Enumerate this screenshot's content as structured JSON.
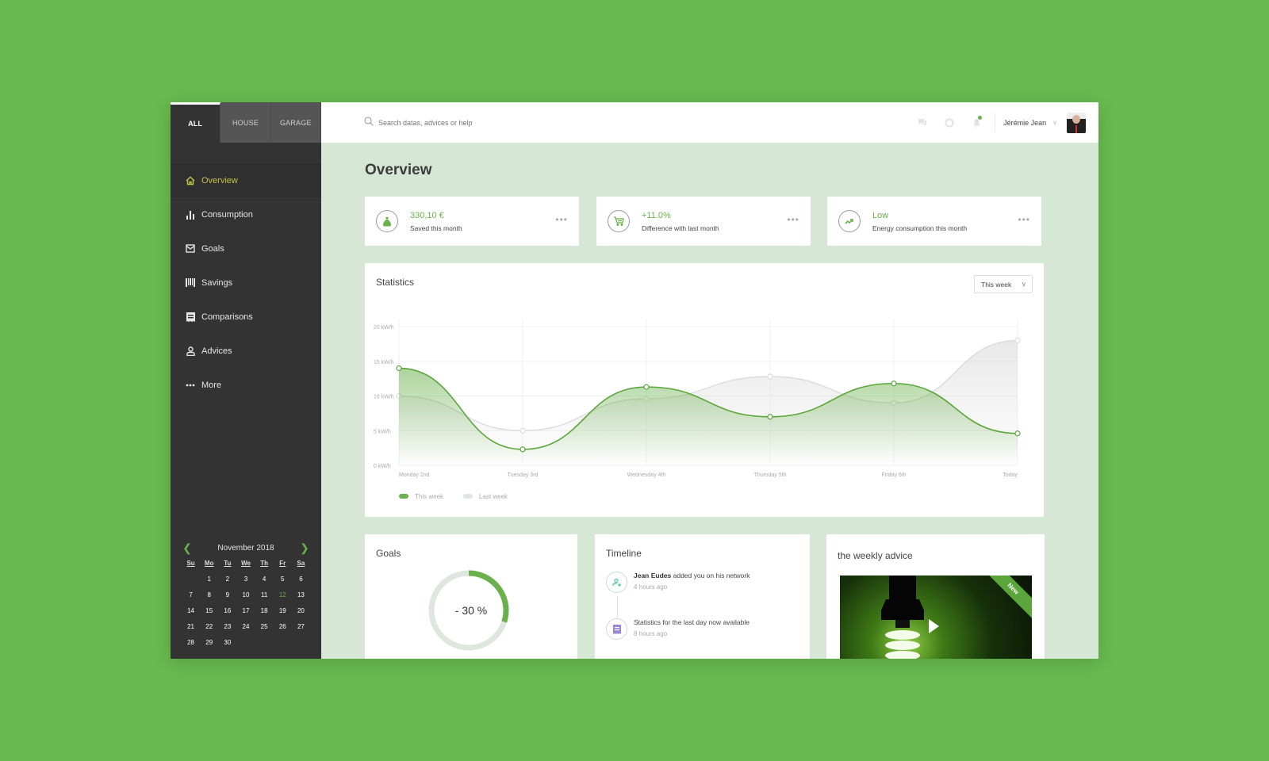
{
  "scope_tabs": [
    {
      "label": "ALL",
      "active": true
    },
    {
      "label": "HOUSE",
      "active": false
    },
    {
      "label": "GARAGE",
      "active": false
    }
  ],
  "search": {
    "placeholder": "Search datas, advices or help",
    "icon": "search-icon"
  },
  "topbar": {
    "icons": [
      "chat-icon",
      "help-icon",
      "bell-icon"
    ],
    "notification_dot_color": "#6ab04c",
    "user_name": "Jérémie Jean"
  },
  "sidebar": {
    "items": [
      {
        "label": "Overview",
        "icon": "home-icon",
        "active": true
      },
      {
        "label": "Consumption",
        "icon": "bar-chart-icon"
      },
      {
        "label": "Goals",
        "icon": "envelope-icon"
      },
      {
        "label": "Savings",
        "icon": "barcode-icon"
      },
      {
        "label": "Comparisons",
        "icon": "receipt-icon"
      },
      {
        "label": "Advices",
        "icon": "user-icon"
      },
      {
        "label": "More",
        "icon": "more-dots-icon"
      }
    ]
  },
  "calendar": {
    "month": "November 2018",
    "dow": [
      "Su",
      "Mo",
      "Tu",
      "We",
      "Th",
      "Fr",
      "Sa"
    ],
    "leading_blanks": 1,
    "days": 30,
    "today": 12
  },
  "page_title": "Overview",
  "kpis": [
    {
      "value": "330,10 €",
      "label": "Saved this month",
      "icon": "money-bag-icon"
    },
    {
      "value": "+11.0%",
      "label": "Difference with last month",
      "icon": "cart-icon"
    },
    {
      "value": "Low",
      "label": "Energy consumption this month",
      "icon": "trend-up-icon"
    }
  ],
  "kpi_more": "•••",
  "statistics": {
    "title": "Statistics",
    "period_select": "This week"
  },
  "chart_data": {
    "type": "area",
    "title": "Statistics",
    "categories": [
      "Monday 2nd",
      "Tuesday 3rd",
      "Wednesday 4th",
      "Thursday 5th",
      "Friday 6th",
      "Today"
    ],
    "yticks": [
      "0 kW/h",
      "5 kW/h",
      "10 kW/h",
      "15 kW/h",
      "20 kW/h"
    ],
    "ylim": [
      0,
      20
    ],
    "unit": "kW/h",
    "series": [
      {
        "name": "This week",
        "color": "#6ab04c",
        "values": [
          14,
          2.3,
          11.3,
          7,
          11.8,
          4.6
        ]
      },
      {
        "name": "Last week",
        "color": "#dddddd",
        "values": [
          10,
          5,
          9.6,
          12.8,
          9,
          18
        ]
      }
    ],
    "grid": true,
    "legend": "bottom-left"
  },
  "goals": {
    "title": "Goals",
    "value_label": "- 30 %",
    "progress": 0.3,
    "color": "#6ab04c"
  },
  "timeline": {
    "title": "Timeline",
    "items": [
      {
        "actor": "Jean Eudes",
        "text": " added you on his network",
        "time": "4 hours ago",
        "icon": "add-user-icon"
      },
      {
        "actor": "",
        "text": "Statistics for the last day now available",
        "time": "8 hours ago",
        "icon": "document-icon"
      }
    ]
  },
  "advice": {
    "title": "the weekly advice",
    "badge": "New"
  }
}
